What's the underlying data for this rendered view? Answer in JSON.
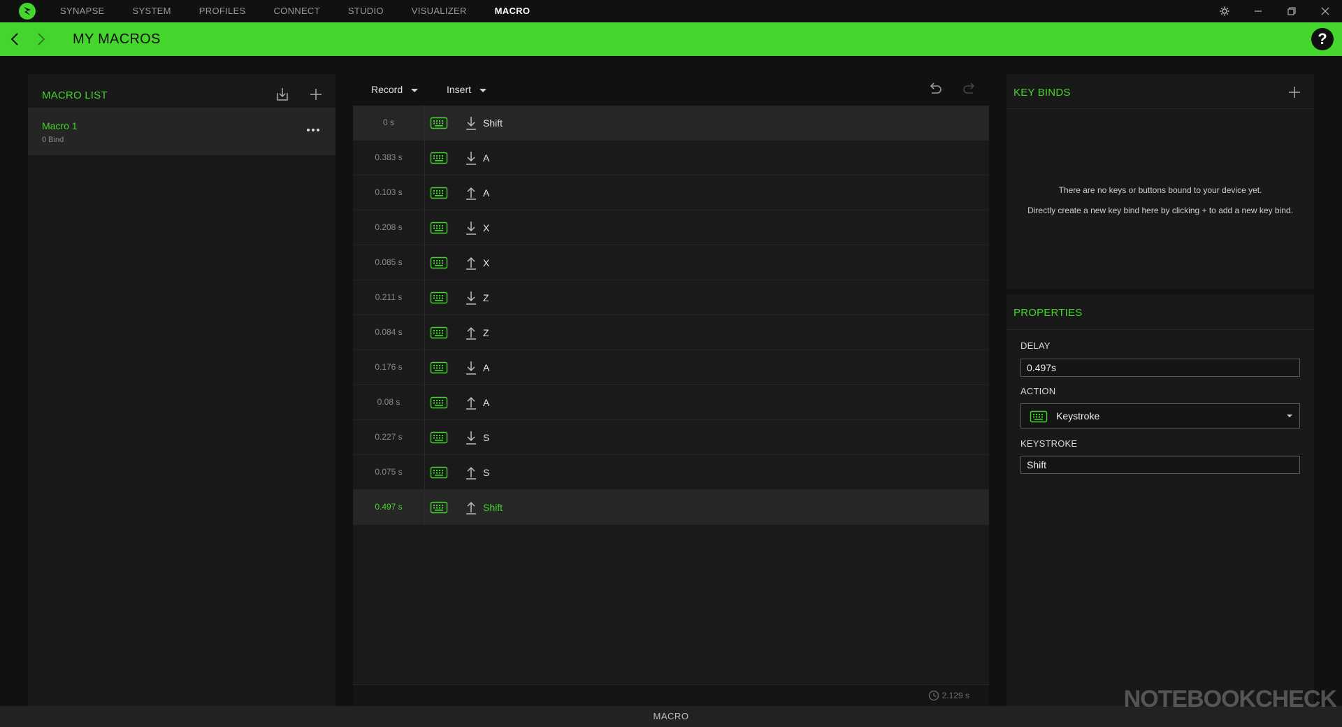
{
  "nav": {
    "items": [
      {
        "label": "SYNAPSE"
      },
      {
        "label": "SYSTEM"
      },
      {
        "label": "PROFILES"
      },
      {
        "label": "CONNECT"
      },
      {
        "label": "STUDIO"
      },
      {
        "label": "VISUALIZER"
      },
      {
        "label": "MACRO",
        "active": true
      }
    ]
  },
  "header": {
    "title": "MY MACROS",
    "help": "?"
  },
  "macro_list": {
    "title": "MACRO LIST",
    "items": [
      {
        "name": "Macro 1",
        "binds": "0 Bind"
      }
    ]
  },
  "editor": {
    "record_label": "Record",
    "insert_label": "Insert",
    "rows": [
      {
        "time": "0 s",
        "dir": "down",
        "key": "Shift"
      },
      {
        "time": "0.383 s",
        "dir": "down",
        "key": "A"
      },
      {
        "time": "0.103 s",
        "dir": "up",
        "key": "A"
      },
      {
        "time": "0.208 s",
        "dir": "down",
        "key": "X"
      },
      {
        "time": "0.085 s",
        "dir": "up",
        "key": "X"
      },
      {
        "time": "0.211 s",
        "dir": "down",
        "key": "Z"
      },
      {
        "time": "0.084 s",
        "dir": "up",
        "key": "Z"
      },
      {
        "time": "0.176 s",
        "dir": "down",
        "key": "A"
      },
      {
        "time": "0.08 s",
        "dir": "up",
        "key": "A"
      },
      {
        "time": "0.227 s",
        "dir": "down",
        "key": "S"
      },
      {
        "time": "0.075 s",
        "dir": "up",
        "key": "S"
      },
      {
        "time": "0.497 s",
        "dir": "up",
        "key": "Shift",
        "selected": true
      }
    ],
    "total_duration": "2.129 s"
  },
  "key_binds": {
    "title": "KEY BINDS",
    "empty_line1": "There are no keys or buttons bound to your device yet.",
    "empty_line2": "Directly create a new key bind here by clicking + to add a new key bind."
  },
  "properties": {
    "title": "PROPERTIES",
    "delay_label": "DELAY",
    "delay_value": "0.497s",
    "action_label": "ACTION",
    "action_value": "Keystroke",
    "keystroke_label": "KEYSTROKE",
    "keystroke_value": "Shift"
  },
  "status_bar": {
    "label": "MACRO"
  },
  "watermark": "NOTEBOOKCHECK",
  "colors": {
    "accent": "#44d62c",
    "background": "#111111",
    "panel": "#191919"
  }
}
